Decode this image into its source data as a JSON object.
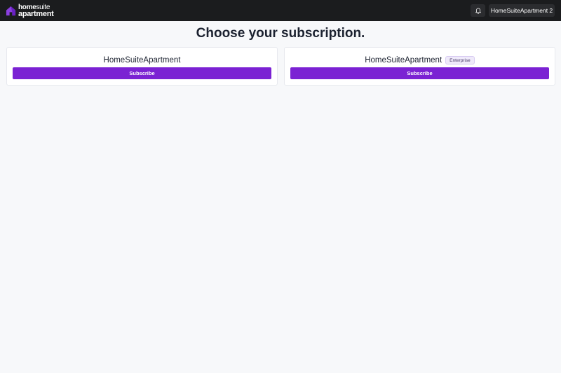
{
  "brand": {
    "logo_line1_bold": "home",
    "logo_line1_light": "suite",
    "logo_line2": "apartment",
    "accent_color": "#7b22d3",
    "logo_icon": "house-icon"
  },
  "header": {
    "notifications_icon": "bell-icon",
    "account_label": "HomeSuiteApartment 2"
  },
  "page": {
    "title": "Choose your subscription."
  },
  "plans": [
    {
      "name": "HomeSuiteApartment",
      "badge": "",
      "button_label": "Subscribe"
    },
    {
      "name": "HomeSuiteApartment",
      "badge": "Enterprise",
      "button_label": "Subscribe"
    }
  ]
}
